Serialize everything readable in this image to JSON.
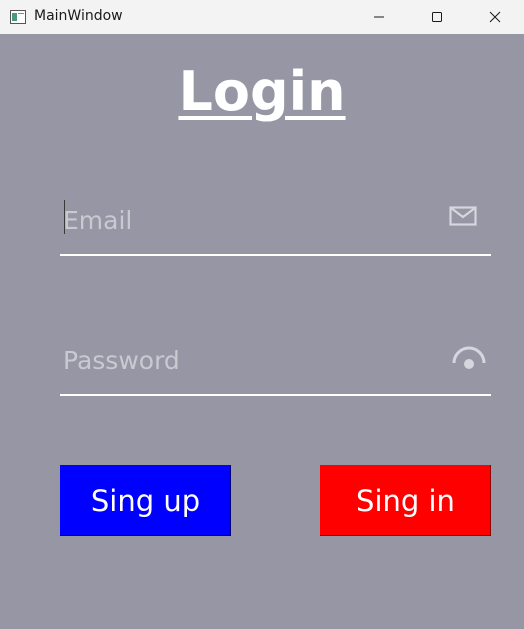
{
  "window": {
    "title": "MainWindow"
  },
  "titlebar_buttons": {
    "minimize_icon": "minimize-icon",
    "maximize_icon": "maximize-icon",
    "close_icon": "close-icon"
  },
  "login": {
    "title": "Login"
  },
  "email": {
    "placeholder": "Email",
    "value": "",
    "icon": "mail-icon"
  },
  "password": {
    "placeholder": "Password",
    "value": "",
    "icon": "eye-icon"
  },
  "buttons": {
    "signup_label": "Sing up",
    "signin_label": "Sing in"
  },
  "colors": {
    "background": "#9696a4",
    "signup": "#0000ff",
    "signin": "#ff0000",
    "text": "#ffffff"
  }
}
